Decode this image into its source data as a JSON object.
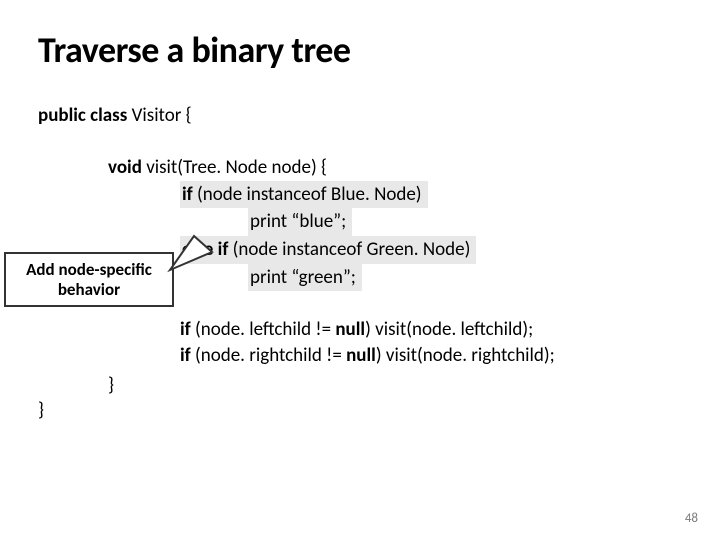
{
  "title": "Traverse a binary tree",
  "class_decl_prefix": "public class ",
  "class_name": "Visitor {",
  "method": {
    "sig_prefix": "void ",
    "sig_rest": "visit(Tree. Node node) {",
    "if_kw": "if ",
    "if_cond": "(node instanceof ",
    "if_type": "Blue. Node)",
    "print_blue": "print “blue”;",
    "elseif_kw": "else if ",
    "elseif_cond": "(node instanceof ",
    "elseif_type": "Green. Node)",
    "print_green": "print “green”;"
  },
  "callout": {
    "line1": "Add node-specific",
    "line2": "behavior"
  },
  "recurse": {
    "l1_a": "if ",
    "l1_b": "(node. leftchild != ",
    "l1_c": "null",
    "l1_d": ")  visit(node. leftchild);",
    "l2_a": "if ",
    "l2_b": "(node. rightchild != ",
    "l2_c": "null",
    "l2_d": ")  visit(node. rightchild);"
  },
  "close_inner": "}",
  "close_outer": "}",
  "page_number": "48"
}
